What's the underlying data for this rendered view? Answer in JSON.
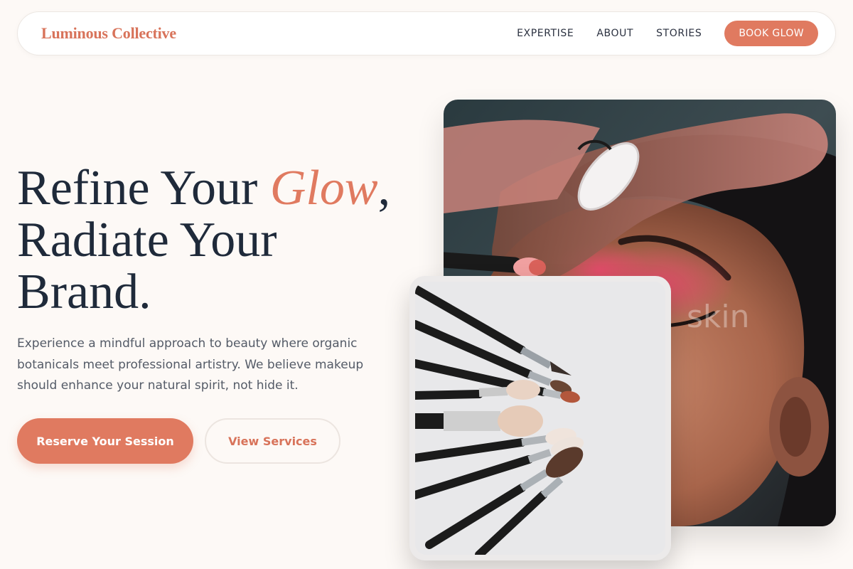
{
  "header": {
    "brand": "Luminous Collective",
    "nav": [
      "EXPERTISE",
      "ABOUT",
      "STORIES"
    ],
    "cta": "BOOK GLOW"
  },
  "hero": {
    "headline_part1": "Refine Your ",
    "headline_accent": "Glow",
    "headline_part2": ",",
    "headline_line2": "Radiate Your",
    "headline_line3": "Brand.",
    "lede": "Experience a mindful approach to beauty where organic botanicals meet professional artistry. We believe makeup should enhance your natural spirit, not hide it.",
    "primary_cta": "Reserve Your Session",
    "secondary_cta": "View Services"
  },
  "images": {
    "main_watermark": "skin",
    "brushes_watermark": ""
  },
  "colors": {
    "accent": "#e07a60",
    "brand": "#d8735a",
    "ink": "#1f2a3a",
    "background": "#fdf9f6"
  }
}
